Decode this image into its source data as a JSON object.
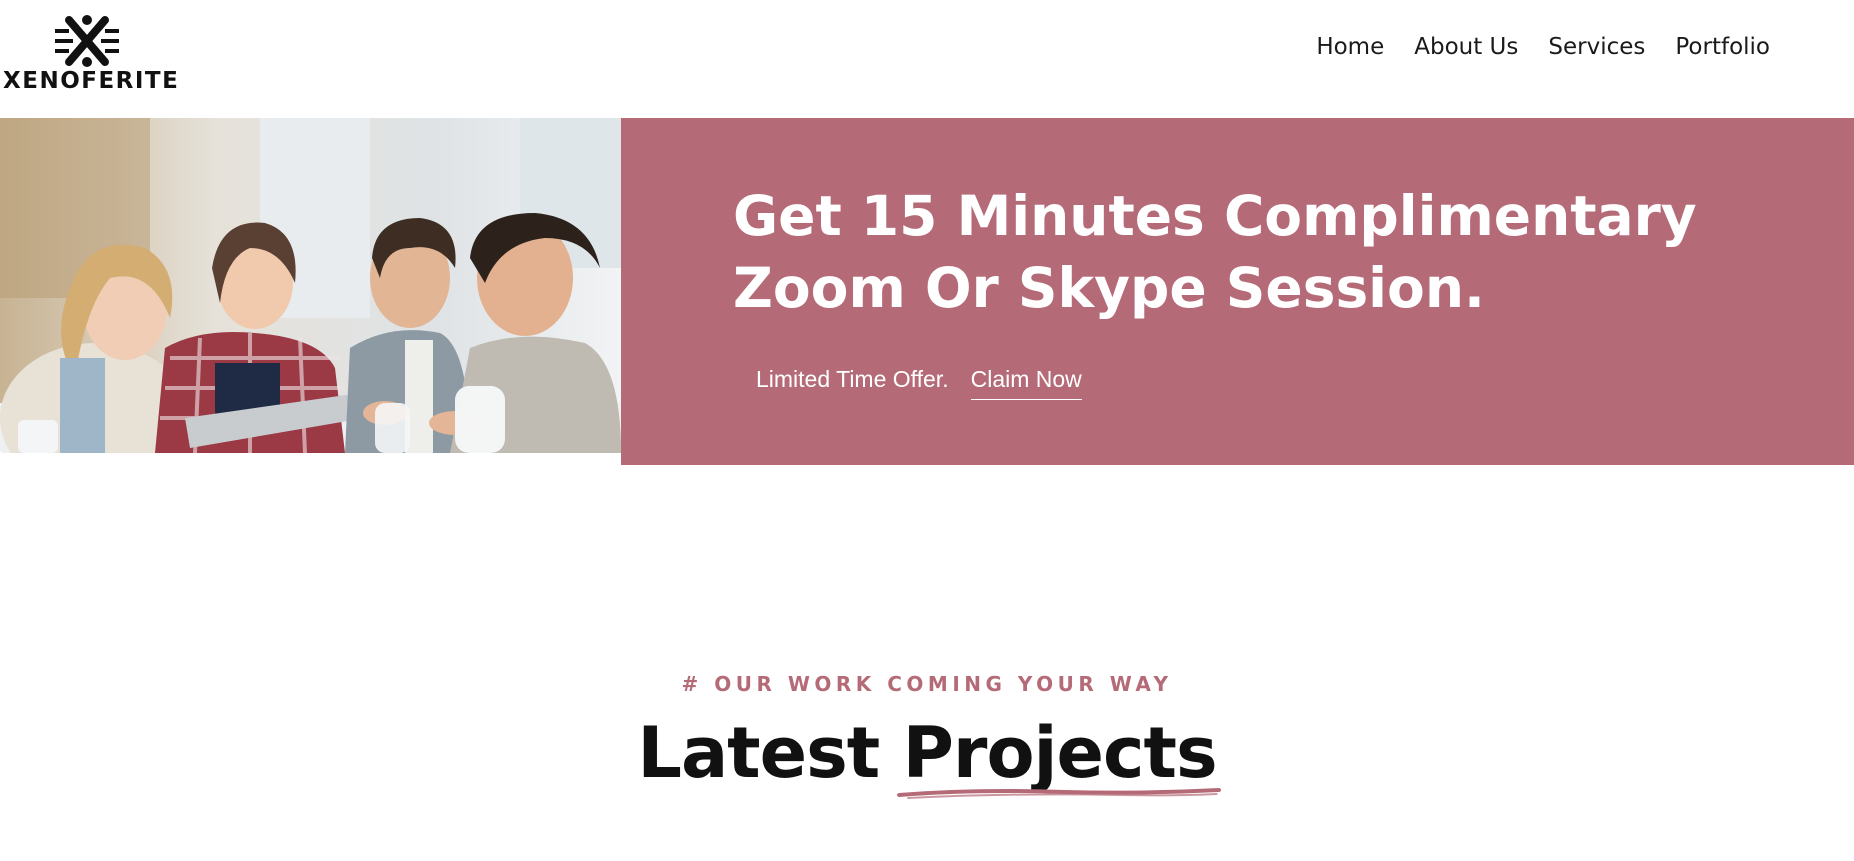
{
  "brand": {
    "name": "XENOFERITE",
    "accent_color": "#b56b77"
  },
  "nav": {
    "items": [
      {
        "label": "Home"
      },
      {
        "label": "About Us"
      },
      {
        "label": "Services"
      },
      {
        "label": "Portfolio"
      }
    ]
  },
  "hero": {
    "title": "Get 15 Minutes Complimentary Zoom Or Skype Session.",
    "offer_text": "Limited Time Offer.",
    "cta_label": "Claim Now",
    "photo": "team-meeting-photo"
  },
  "projects": {
    "eyebrow": "# OUR WORK COMING YOUR WAY",
    "title_plain": "Latest",
    "title_accent": "Projects"
  }
}
